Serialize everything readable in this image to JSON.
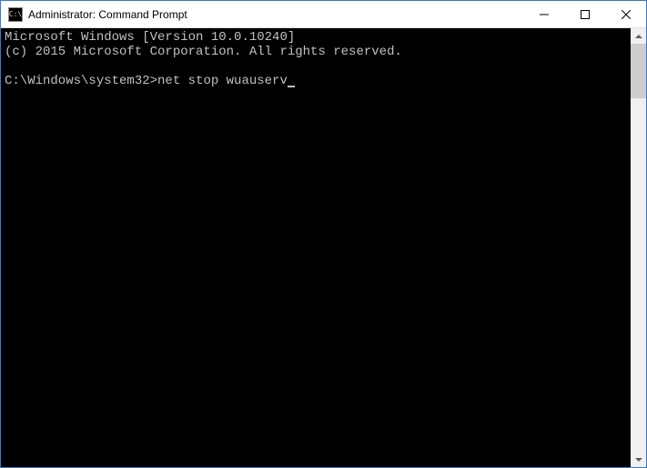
{
  "titlebar": {
    "icon_label": "C:\\",
    "title": "Administrator: Command Prompt"
  },
  "terminal": {
    "line1": "Microsoft Windows [Version 10.0.10240]",
    "line2": "(c) 2015 Microsoft Corporation. All rights reserved.",
    "blank1": "",
    "prompt": "C:\\Windows\\system32>",
    "command": "net stop wuauserv"
  }
}
